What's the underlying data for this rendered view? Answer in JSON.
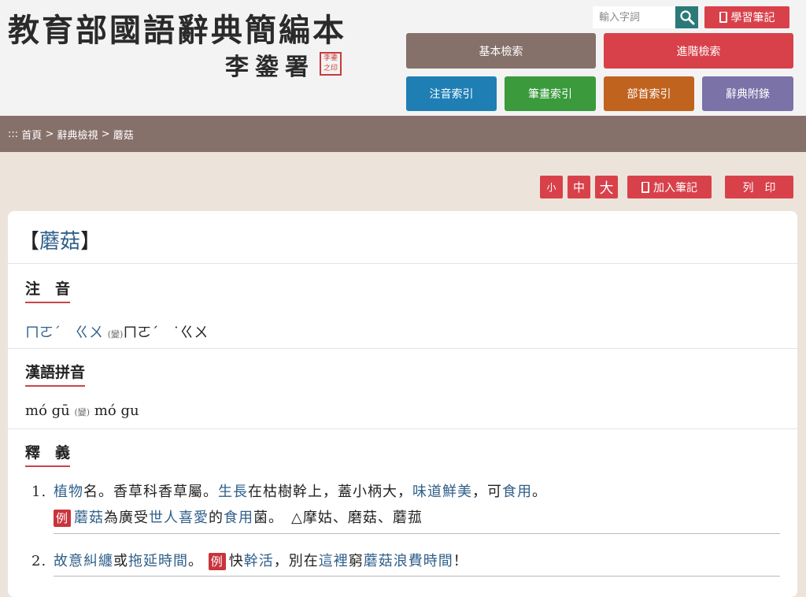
{
  "header": {
    "logo_title": "教育部國語辭典簡編本",
    "logo_subtitle": "李鍌署",
    "seal_text": "李鍌之印",
    "search_placeholder": "輸入字詞",
    "notes_label": "學習筆記"
  },
  "nav": {
    "basic": "基本檢索",
    "advanced": "進階檢索",
    "zhuyin_index": "注音索引",
    "stroke_index": "筆畫索引",
    "radical_index": "部首索引",
    "appendix": "辭典附錄"
  },
  "breadcrumb": {
    "prefix": ":::",
    "home": "首頁",
    "sep1": ">",
    "view": "辭典檢視",
    "sep2": ">",
    "current": "蘑菇"
  },
  "tools": {
    "small": "小",
    "medium": "中",
    "large": "大",
    "add_note": "加入筆記",
    "print": "列　印"
  },
  "entry": {
    "open": "【",
    "word": "蘑菇",
    "close": "】",
    "zhuyin_title": "注　音",
    "zhuyin_main": "ㄇㄛˊ　ㄍㄨ",
    "variant_mark": "(變)",
    "zhuyin_variant": "ㄇㄛˊ　˙ㄍㄨ",
    "pinyin_title": "漢語拼音",
    "pinyin_main": "mó  gū",
    "pinyin_variant": "mó  gu",
    "def_title": "釋　義",
    "definitions": [
      {
        "num": "1.",
        "parts": [
          "植物",
          "名。香草科香草屬。",
          "生長",
          "在枯樹幹上，蓋小柄大，",
          "味道",
          "鮮美",
          "，可",
          "食用",
          "。"
        ],
        "example": {
          "badge": "例",
          "parts": [
            "蘑菇",
            "為廣受",
            "世人",
            "喜愛",
            "的",
            "食用",
            "菌。　△摩姑、磨菇、蘑菰"
          ]
        }
      },
      {
        "num": "2.",
        "parts": [
          "故意",
          "糾纏",
          "或",
          "拖延",
          "時間",
          "。 "
        ],
        "badge": "例",
        "example_parts": [
          "快",
          "幹活",
          "，別在",
          "這裡",
          "窮",
          "蘑菇",
          "浪費",
          "時間",
          "！"
        ]
      }
    ]
  },
  "colors": {
    "accent_red": "#d8414a",
    "nav_brown": "#86706a",
    "nav_blue": "#1f7fb5",
    "nav_green": "#3a9a3c",
    "nav_orange": "#c0631f",
    "nav_purple": "#7b72a8",
    "link_blue": "#2f5f8a"
  }
}
